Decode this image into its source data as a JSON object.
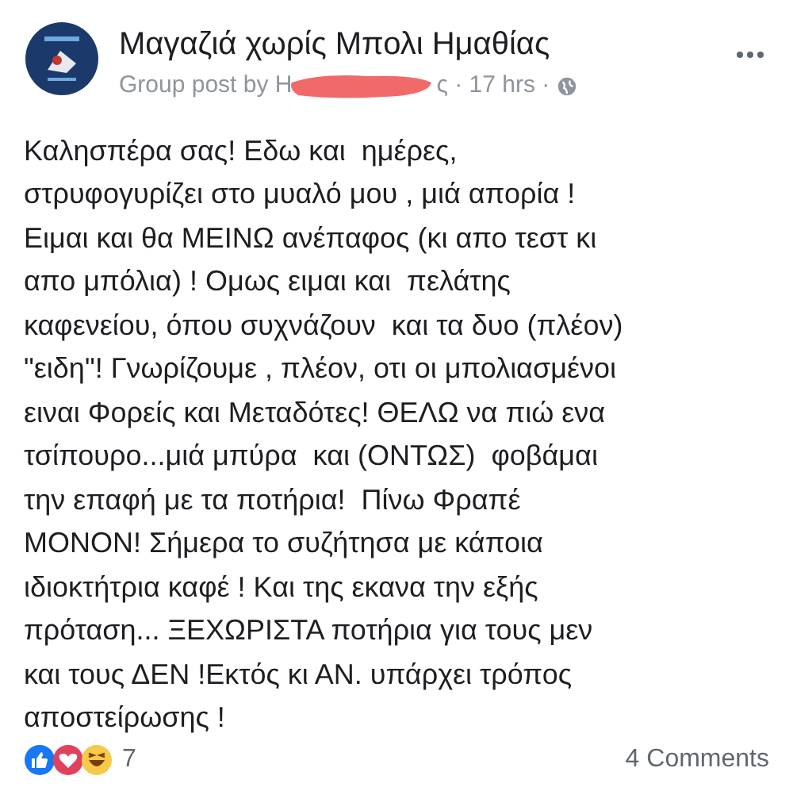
{
  "post": {
    "group_name": "Μαγαζιά χωρίς Μπολι Ημαθίας",
    "byline_start": "Group post by Η",
    "byline_end": "ς · 17 hrs ·",
    "body": "Καλησπέρα σας! Εδω και  ημέρες,\nστρυφογυρίζει στο μυαλό μου , μιά απορία !\nΕιμαι και θα ΜΕΙΝΩ ανέπαφος (κι απο τεστ κι\nαπο μπόλια) ! Ομως ειμαι και  πελάτης\nκαφενείου, όπου συχνάζουν  και τα δυο (πλέον)\n\"ειδη\"! Γνωρίζουμε , πλέον, οτι οι μπολιασμένοι\nειναι Φορείς και Μεταδότες! ΘΕΛΩ να πιώ ενα\nτσίπουρο...μιά μπύρα  και (ΟΝΤΩΣ)  φοβάμαι\nτην επαφή με τα ποτήρια!  Πίνω Φραπέ\nΜΟΝΟΝ! Σήμερα το συζήτησα με κάποια\nιδιοκτήτρια καφέ ! Και της εκανα την εξής\nπρόταση... ΞΕΧΩΡΙΣΤΑ ποτήρια για τους μεν\nκαι τους ΔΕΝ !Εκτός κι ΑΝ. υπάρχει τρόπος\nαποστείρωσης !",
    "reaction_count": "7",
    "comments": "4 Comments"
  }
}
